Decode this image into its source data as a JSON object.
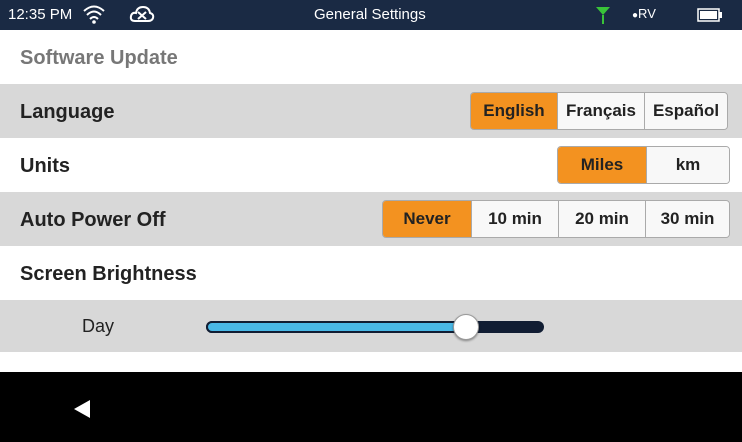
{
  "status_bar": {
    "time": "12:35 PM",
    "title": "General Settings",
    "rv_label": "RV",
    "icons": [
      "wifi-icon",
      "cloud-off-icon",
      "antenna-icon",
      "battery-icon"
    ]
  },
  "colors": {
    "status_bar_bg": "#1a2a44",
    "accent": "#f39220",
    "row_grey": "#d8d8d8",
    "slider_fill": "#49b8e6",
    "slider_track": "#111d33",
    "antenna": "#39c339"
  },
  "settings": {
    "software_update": "Software Update",
    "language": {
      "label": "Language",
      "options": [
        "English",
        "Français",
        "Español"
      ],
      "selected": "English"
    },
    "units": {
      "label": "Units",
      "options": [
        "Miles",
        "km"
      ],
      "selected": "Miles"
    },
    "auto_power_off": {
      "label": "Auto Power Off",
      "options": [
        "Never",
        "10 min",
        "20 min",
        "30 min"
      ],
      "selected": "Never"
    },
    "screen_brightness": {
      "label": "Screen Brightness",
      "day_label": "Day",
      "day_level": 0.77
    }
  },
  "nav": {
    "icons": [
      "back-icon"
    ]
  }
}
